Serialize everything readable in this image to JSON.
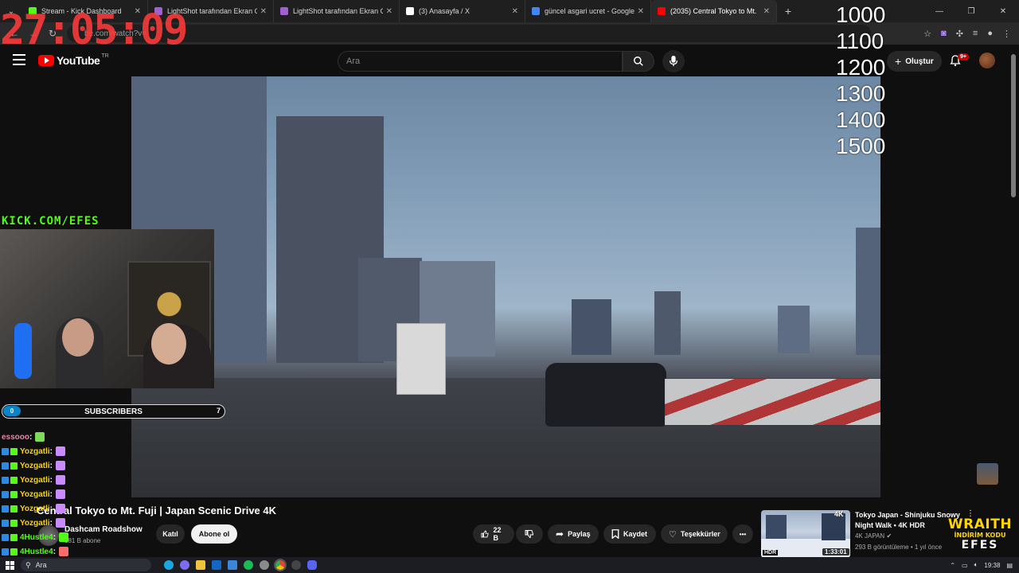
{
  "browser": {
    "tabs": [
      {
        "title": "Stream - Kick Dashboard",
        "favicon_color": "#53fc18"
      },
      {
        "title": "LightShot tarafından Ekran Gön",
        "favicon_color": "#a060d0"
      },
      {
        "title": "LightShot tarafından Ekran Gön",
        "favicon_color": "#a060d0"
      },
      {
        "title": "(3) Anasayfa / X",
        "favicon_color": "#ffffff"
      },
      {
        "title": "güncel asgari ucret - Google'da",
        "favicon_color": "#4285f4"
      },
      {
        "title": "(2035) Central Tokyo to Mt.",
        "favicon_color": "#ff0000"
      }
    ],
    "new_tab": "+",
    "address": "be.com/watch?v=",
    "window_controls": [
      "—",
      "❐",
      "✕"
    ]
  },
  "overlay": {
    "timer": "27:05:09",
    "goals": [
      "1000",
      "1100",
      "1200",
      "1300",
      "1400",
      "1500"
    ],
    "kick_label": "KICK.COM/EFES",
    "subs_start": "0",
    "subs_label": "SUBSCRIBERS",
    "subs_end": "7",
    "subs_progress": 0
  },
  "chat": [
    {
      "user": "essooo",
      "sep": " :",
      "color": "#ff7aa8"
    },
    {
      "user": "Yozgatli",
      "sep": " :",
      "color": "#ffd400"
    },
    {
      "user": "Yozgatli",
      "sep": " :",
      "color": "#ffd400"
    },
    {
      "user": "Yozgatli",
      "sep": " :",
      "color": "#ffd400"
    },
    {
      "user": "Yozgatli",
      "sep": " :",
      "color": "#ffd400"
    },
    {
      "user": "Yozgatli",
      "sep": " :",
      "color": "#ffd400"
    },
    {
      "user": "Yozgatli",
      "sep": " :",
      "color": "#ffd400"
    },
    {
      "user": "4Hustle4",
      "sep": " :",
      "color": "#53fc18"
    },
    {
      "user": "4Hustle4",
      "sep": " :",
      "color": "#53fc18"
    }
  ],
  "youtube": {
    "logo": "YouTube",
    "region": "TR",
    "search_placeholder": "Ara",
    "create_label": "Oluştur",
    "notif_badge": "9+",
    "video_title": "Central Tokyo to Mt. Fuji | Japan Scenic Drive 4K",
    "channel_name": "Dashcam Roadshow",
    "channel_subs": "181 B abone",
    "join_label": "Katıl",
    "subscribe_label": "Abone ol",
    "likes": "22 B",
    "share_label": "Paylaş",
    "save_label": "Kaydet",
    "thanks_label": "Teşekkürler",
    "more_label": "•••"
  },
  "recommendation": {
    "title": "Tokyo Japan - Shinjuku Snowy Night Walk • 4K HDR",
    "channel": "4K JAPAN",
    "meta": "293 B görüntüleme • 1 yıl önce",
    "duration": "1:33:01",
    "badge_4k": "4K",
    "badge_hdr": "HDR",
    "more": "⋮"
  },
  "brand": {
    "name": "WRAITH",
    "code_label": "İNDİRİM KODU",
    "code": "EFES"
  },
  "taskbar": {
    "search": "Ara",
    "time": "19:38"
  },
  "colors": {
    "timer": "#ff3b3b",
    "kick_green": "#53fc18",
    "yt_red": "#ff0000",
    "brand_yellow": "#ffd400"
  }
}
